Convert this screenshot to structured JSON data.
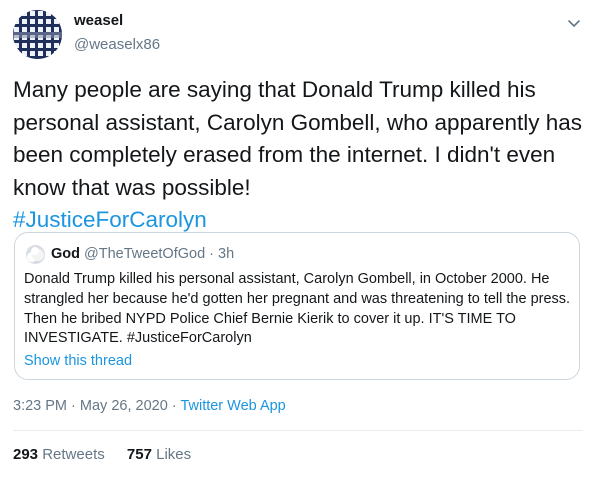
{
  "tweet": {
    "author": {
      "display_name": "weasel",
      "handle": "@weaselx86",
      "avatar_icon": "checkerboard-avatar"
    },
    "menu_icon": "chevron-down-icon",
    "text": "Many people are saying that Donald Trump killed his personal assistant, Carolyn Gombell, who apparently has been completely erased from the internet.  I didn't even know that was possible!",
    "hashtag": "#JusticeForCarolyn",
    "quoted": {
      "display_name": "God",
      "handle": "@TheTweetOfGod",
      "separator": "·",
      "time": "3h",
      "text": "Donald Trump killed his personal assistant, Carolyn Gombell, in October 2000. He strangled her because he'd gotten her pregnant and was threatening to tell the press. Then he bribed NYPD Police Chief Bernie Kierik to cover it up. IT'S TIME TO INVESTIGATE. #JusticeForCarolyn",
      "show_thread": "Show this thread"
    },
    "meta": {
      "time": "3:23 PM",
      "separator1": "·",
      "date": "May 26, 2020",
      "separator2": "·",
      "source": "Twitter Web App"
    },
    "stats": {
      "retweets_count": "293",
      "retweets_label": "Retweets",
      "likes_count": "757",
      "likes_label": "Likes"
    },
    "colors": {
      "link": "#1b95e0",
      "secondary_text": "#657786",
      "border": "#ccd6dd"
    }
  }
}
